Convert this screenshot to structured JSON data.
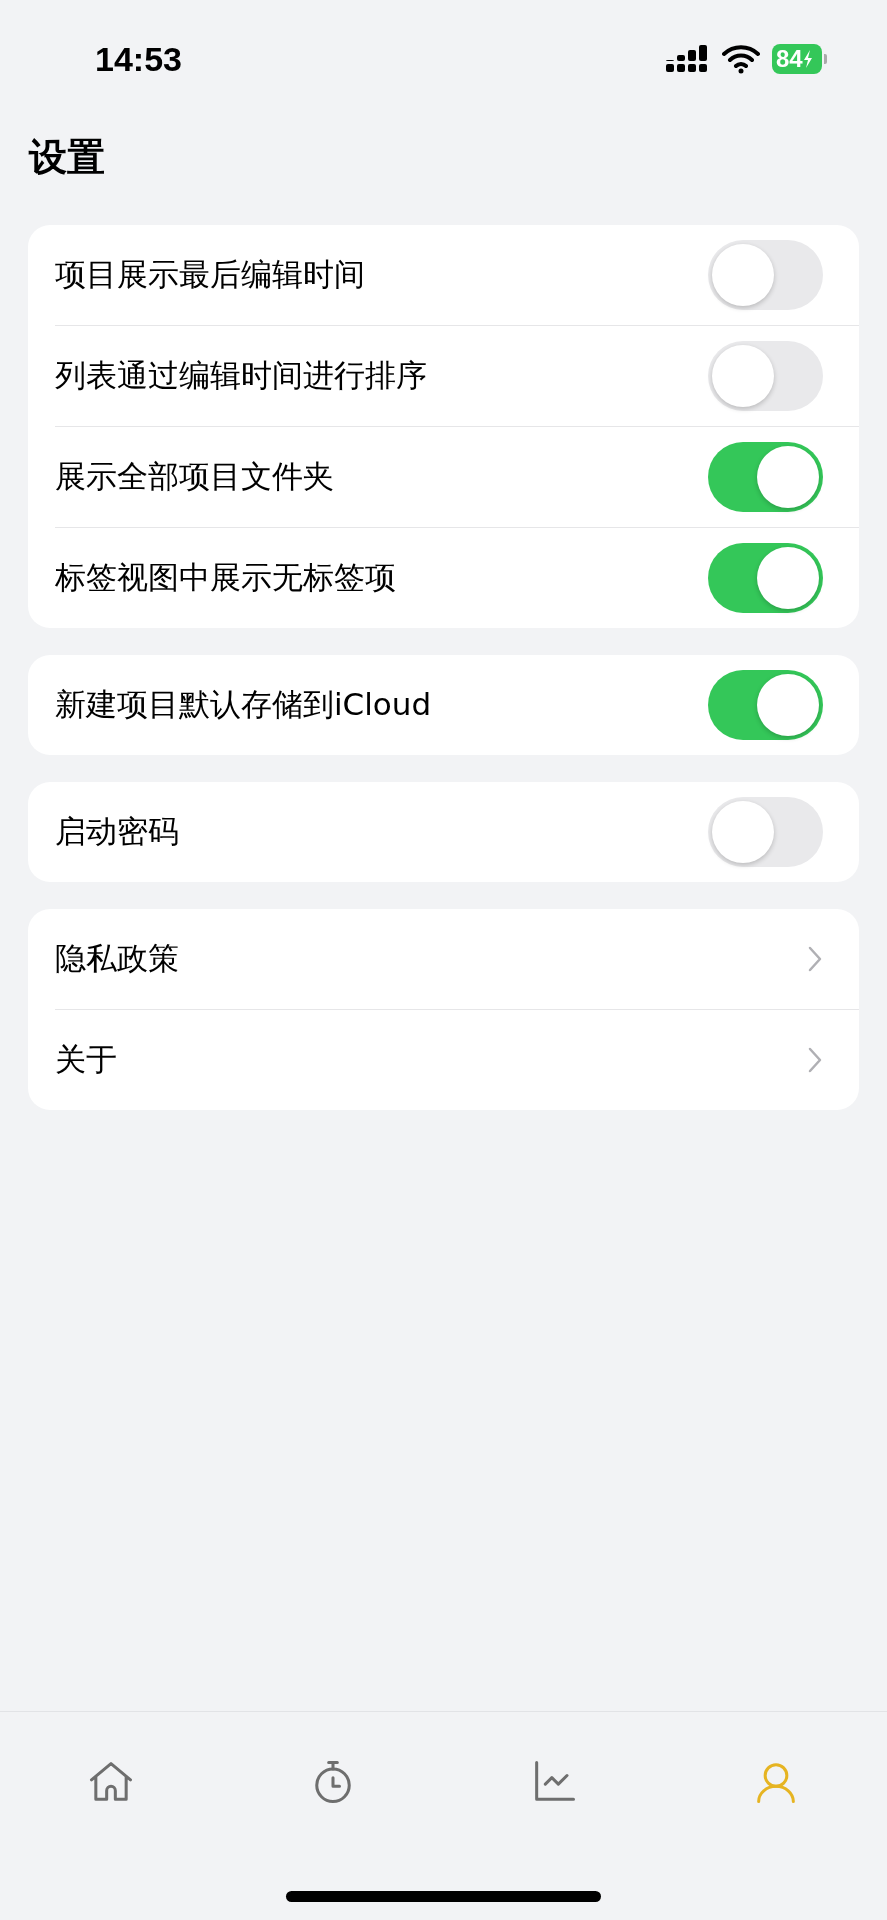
{
  "status_bar": {
    "time": "14:53",
    "battery": "84"
  },
  "title": "设置",
  "groups": [
    {
      "rows": [
        {
          "kind": "toggle",
          "label": "项目展示最后编辑时间",
          "on": false
        },
        {
          "kind": "toggle",
          "label": "列表通过编辑时间进行排序",
          "on": false
        },
        {
          "kind": "toggle",
          "label": "展示全部项目文件夹",
          "on": true
        },
        {
          "kind": "toggle",
          "label": "标签视图中展示无标签项",
          "on": true
        }
      ]
    },
    {
      "rows": [
        {
          "kind": "toggle",
          "label": "新建项目默认存储到iCloud",
          "on": true
        }
      ]
    },
    {
      "rows": [
        {
          "kind": "toggle",
          "label": "启动密码",
          "on": false
        }
      ]
    },
    {
      "rows": [
        {
          "kind": "link",
          "label": "隐私政策"
        },
        {
          "kind": "link",
          "label": "关于"
        }
      ]
    }
  ],
  "tab_bar": [
    {
      "kind": "home",
      "selected": false
    },
    {
      "kind": "timer",
      "selected": false
    },
    {
      "kind": "chart",
      "selected": false
    },
    {
      "kind": "person",
      "selected": true
    }
  ]
}
